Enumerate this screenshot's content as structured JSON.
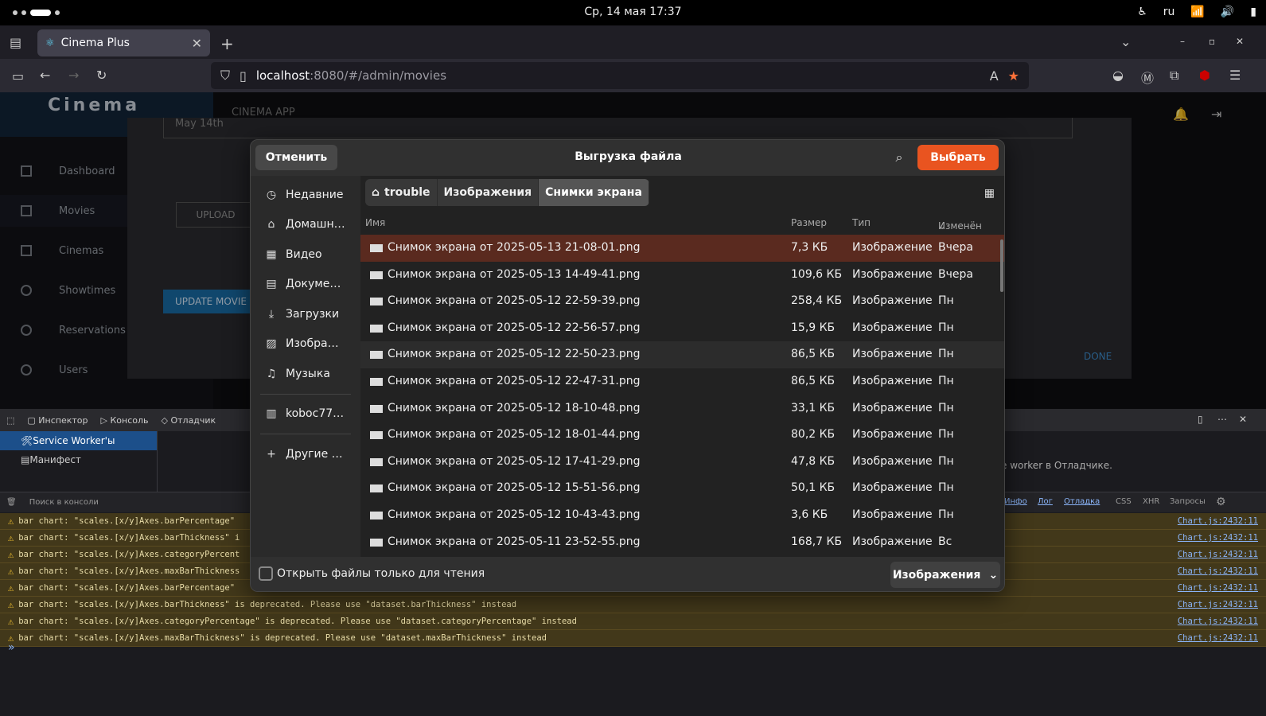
{
  "system": {
    "clock": "Ср, 14 мая  17:37",
    "lang": "ru"
  },
  "browser": {
    "tab_title": "Cinema Plus",
    "url_host": "localhost",
    "url_rest": ":8080/#/admin/movies"
  },
  "app": {
    "logo": "Cinema",
    "header": "CINEMA APP",
    "date_field": "May 14th",
    "upload_label": "UPLOAD",
    "update_label": "UPDATE MOVIE",
    "done_label": "DONE",
    "sidebar": [
      {
        "label": "Dashboard"
      },
      {
        "label": "Movies"
      },
      {
        "label": "Cinemas"
      },
      {
        "label": "Showtimes"
      },
      {
        "label": "Reservations"
      },
      {
        "label": "Users"
      }
    ]
  },
  "devtools": {
    "tabs": [
      "Инспектор",
      "Консоль",
      "Отладчик"
    ],
    "side": [
      "Service Worker'ы",
      "Манифест"
    ],
    "search_placeholder": "Поиск в консоли",
    "sw_hint": "e worker в Отладчике.",
    "filters": [
      "Инфо",
      "Лог",
      "Отладка",
      "CSS",
      "XHR",
      "Запросы"
    ],
    "warnings": [
      "bar chart: \"scales.[x/y]Axes.barPercentage\"",
      "bar chart: \"scales.[x/y]Axes.barThickness\" i",
      "bar chart: \"scales.[x/y]Axes.categoryPercent",
      "bar chart: \"scales.[x/y]Axes.maxBarThickness",
      "bar chart: \"scales.[x/y]Axes.barPercentage\"",
      "bar chart: \"scales.[x/y]Axes.barThickness\" is deprecated. Please use \"dataset.barThickness\" instead",
      "bar chart: \"scales.[x/y]Axes.categoryPercentage\" is deprecated. Please use \"dataset.categoryPercentage\" instead",
      "bar chart: \"scales.[x/y]Axes.maxBarThickness\" is deprecated. Please use \"dataset.maxBarThickness\" instead"
    ],
    "warning_source": "Chart.js:2432:11"
  },
  "dialog": {
    "cancel": "Отменить",
    "title": "Выгрузка файла",
    "select": "Выбрать",
    "places": [
      "Недавние",
      "Домашн…",
      "Видео",
      "Докуме…",
      "Загрузки",
      "Изобра…",
      "Музыка",
      "koboc77…",
      "Другие …"
    ],
    "crumbs": [
      "trouble",
      "Изображения",
      "Снимки экрана"
    ],
    "columns": {
      "name": "Имя",
      "size": "Размер",
      "type": "Тип",
      "modified": "Изменён"
    },
    "files": [
      {
        "name": "Снимок экрана от 2025-05-13 21-08-01.png",
        "size": "7,3 КБ",
        "type": "Изображение",
        "modified": "Вчера"
      },
      {
        "name": "Снимок экрана от 2025-05-13 14-49-41.png",
        "size": "109,6 КБ",
        "type": "Изображение",
        "modified": "Вчера"
      },
      {
        "name": "Снимок экрана от 2025-05-12 22-59-39.png",
        "size": "258,4 КБ",
        "type": "Изображение",
        "modified": "Пн"
      },
      {
        "name": "Снимок экрана от 2025-05-12 22-56-57.png",
        "size": "15,9 КБ",
        "type": "Изображение",
        "modified": "Пн"
      },
      {
        "name": "Снимок экрана от 2025-05-12 22-50-23.png",
        "size": "86,5 КБ",
        "type": "Изображение",
        "modified": "Пн"
      },
      {
        "name": "Снимок экрана от 2025-05-12 22-47-31.png",
        "size": "86,5 КБ",
        "type": "Изображение",
        "modified": "Пн"
      },
      {
        "name": "Снимок экрана от 2025-05-12 18-10-48.png",
        "size": "33,1 КБ",
        "type": "Изображение",
        "modified": "Пн"
      },
      {
        "name": "Снимок экрана от 2025-05-12 18-01-44.png",
        "size": "80,2 КБ",
        "type": "Изображение",
        "modified": "Пн"
      },
      {
        "name": "Снимок экрана от 2025-05-12 17-41-29.png",
        "size": "47,8 КБ",
        "type": "Изображение",
        "modified": "Пн"
      },
      {
        "name": "Снимок экрана от 2025-05-12 15-51-56.png",
        "size": "50,1 КБ",
        "type": "Изображение",
        "modified": "Пн"
      },
      {
        "name": "Снимок экрана от 2025-05-12 10-43-43.png",
        "size": "3,6 КБ",
        "type": "Изображение",
        "modified": "Пн"
      },
      {
        "name": "Снимок экрана от 2025-05-11 23-52-55.png",
        "size": "168,7 КБ",
        "type": "Изображение",
        "modified": "Вс"
      }
    ],
    "readonly_label": "Открыть файлы только для чтения",
    "filter": "Изображения"
  },
  "colors": {
    "accent": "#e95420",
    "selected_row": "#5a2a1f"
  }
}
